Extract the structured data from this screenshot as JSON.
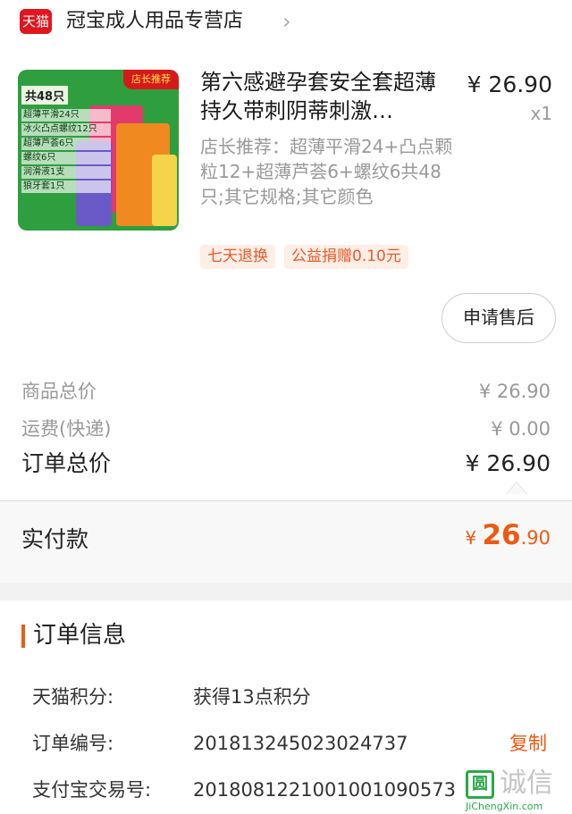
{
  "shop": {
    "logo_text": "天猫",
    "name": "冠宝成人用品专营店",
    "chevron": "›"
  },
  "product": {
    "image": {
      "tag_total": "共48只",
      "tag_recommend": "店长推荐",
      "lines": [
        "超薄平滑24只",
        "冰火凸点螺纹12只",
        "超薄芦荟6只",
        "螺纹6只",
        "润滑液1支",
        "狼牙套1只"
      ]
    },
    "title": "第六感避孕套安全套超薄持久带刺阴蒂刺激…",
    "price": "¥ 26.90",
    "quantity": "x1",
    "sku": "店长推荐：超薄平滑24+凸点颗粒12+超薄芦荟6+螺纹6共48只;其它规格;其它颜色",
    "tags": [
      "七天退换",
      "公益捐赠0.10元"
    ],
    "after_sale_button": "申请售后"
  },
  "summary": {
    "goods_total_label": "商品总价",
    "goods_total_value": "¥ 26.90",
    "shipping_label": "运费(快递)",
    "shipping_value": "¥ 0.00",
    "order_total_label": "订单总价",
    "order_total_value": "¥ 26.90"
  },
  "payment": {
    "label": "实付款",
    "currency": "¥ ",
    "integer": "26",
    "decimal": ".90"
  },
  "order_info": {
    "title": "订单信息",
    "rows": [
      {
        "label": "天猫积分:",
        "value": "获得13点积分"
      },
      {
        "label": "订单编号:",
        "value": "201813245023024737",
        "action": "复制"
      },
      {
        "label": "支付宝交易号:",
        "value": "2018081221001001090573"
      }
    ]
  },
  "watermark": {
    "box": "圆",
    "text": "诚信",
    "url": "JiChengXin.com"
  },
  "colors": {
    "accent": "#ee5a12",
    "tmall_red": "#e0151e",
    "tag_bg": "#fdeee6",
    "muted_text": "#999999"
  }
}
